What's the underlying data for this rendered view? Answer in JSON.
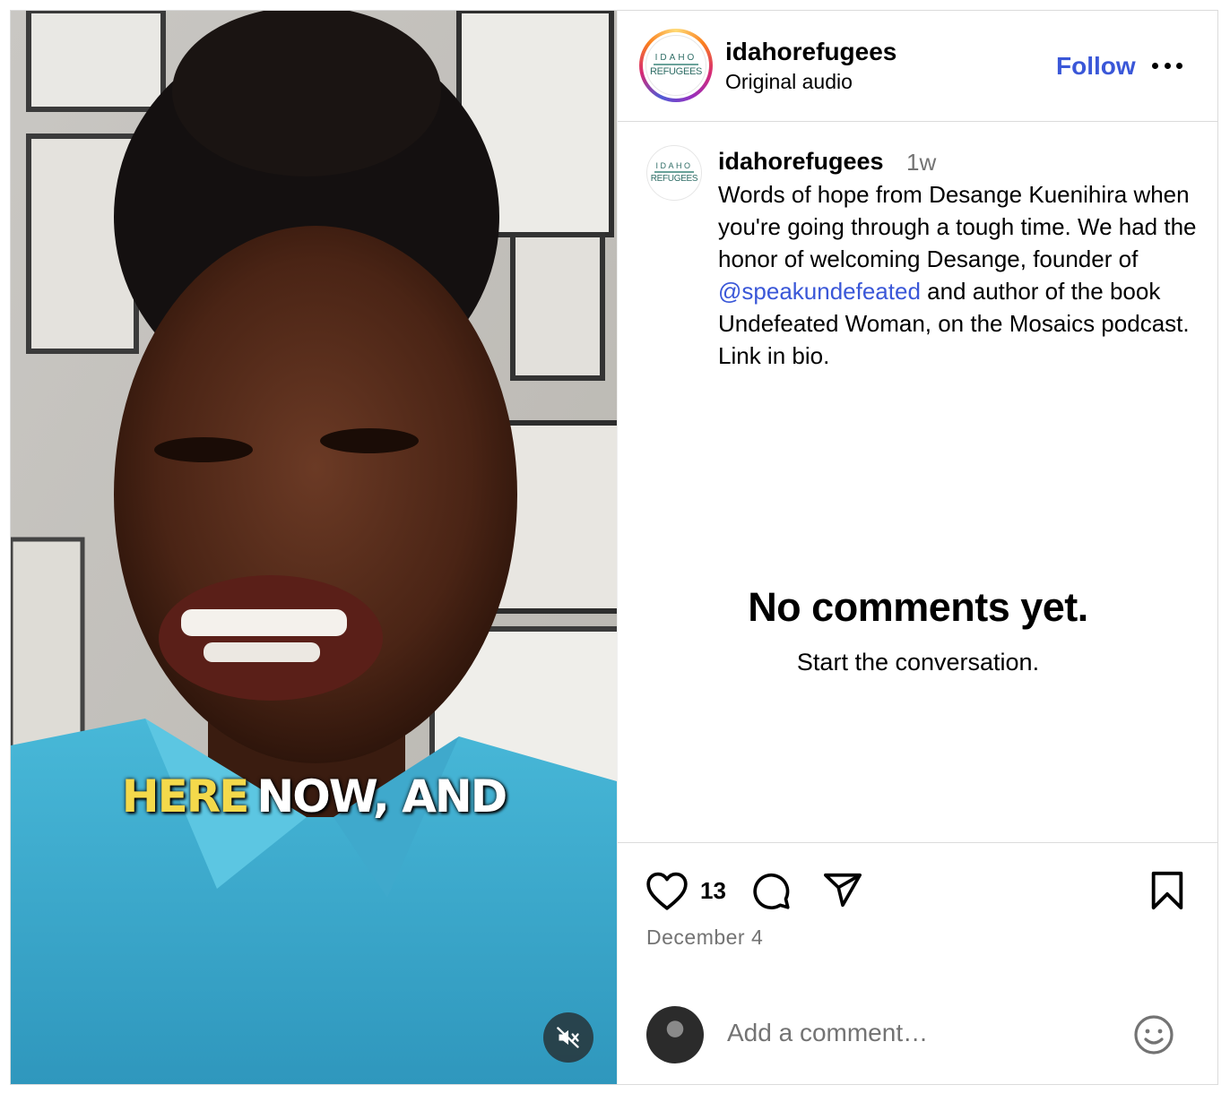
{
  "header": {
    "username": "idahorefugees",
    "audio": "Original audio",
    "follow_label": "Follow"
  },
  "logo": {
    "top": "IDAHO",
    "bottom": "REFUGEES"
  },
  "video": {
    "caption_highlight": "HERE",
    "caption_rest": "NOW, AND"
  },
  "caption": {
    "username": "idahorefugees",
    "time": "1w",
    "text_before": "Words of hope from Desange Kuenihira when you're going through a tough time. We had the honor of welcoming Desange, founder of ",
    "mention": "@speakundefeated",
    "text_after": " and author of the book Undefeated Woman, on the Mosaics podcast. Link in bio."
  },
  "comments": {
    "empty_title": "No comments yet.",
    "empty_sub": "Start the conversation."
  },
  "actions": {
    "like_count": "13",
    "date": "December 4"
  },
  "comment_box": {
    "placeholder": "Add a comment…"
  },
  "colors": {
    "link": "#3a57d8",
    "muted": "#737373",
    "caption_highlight": "#f4d94b"
  }
}
